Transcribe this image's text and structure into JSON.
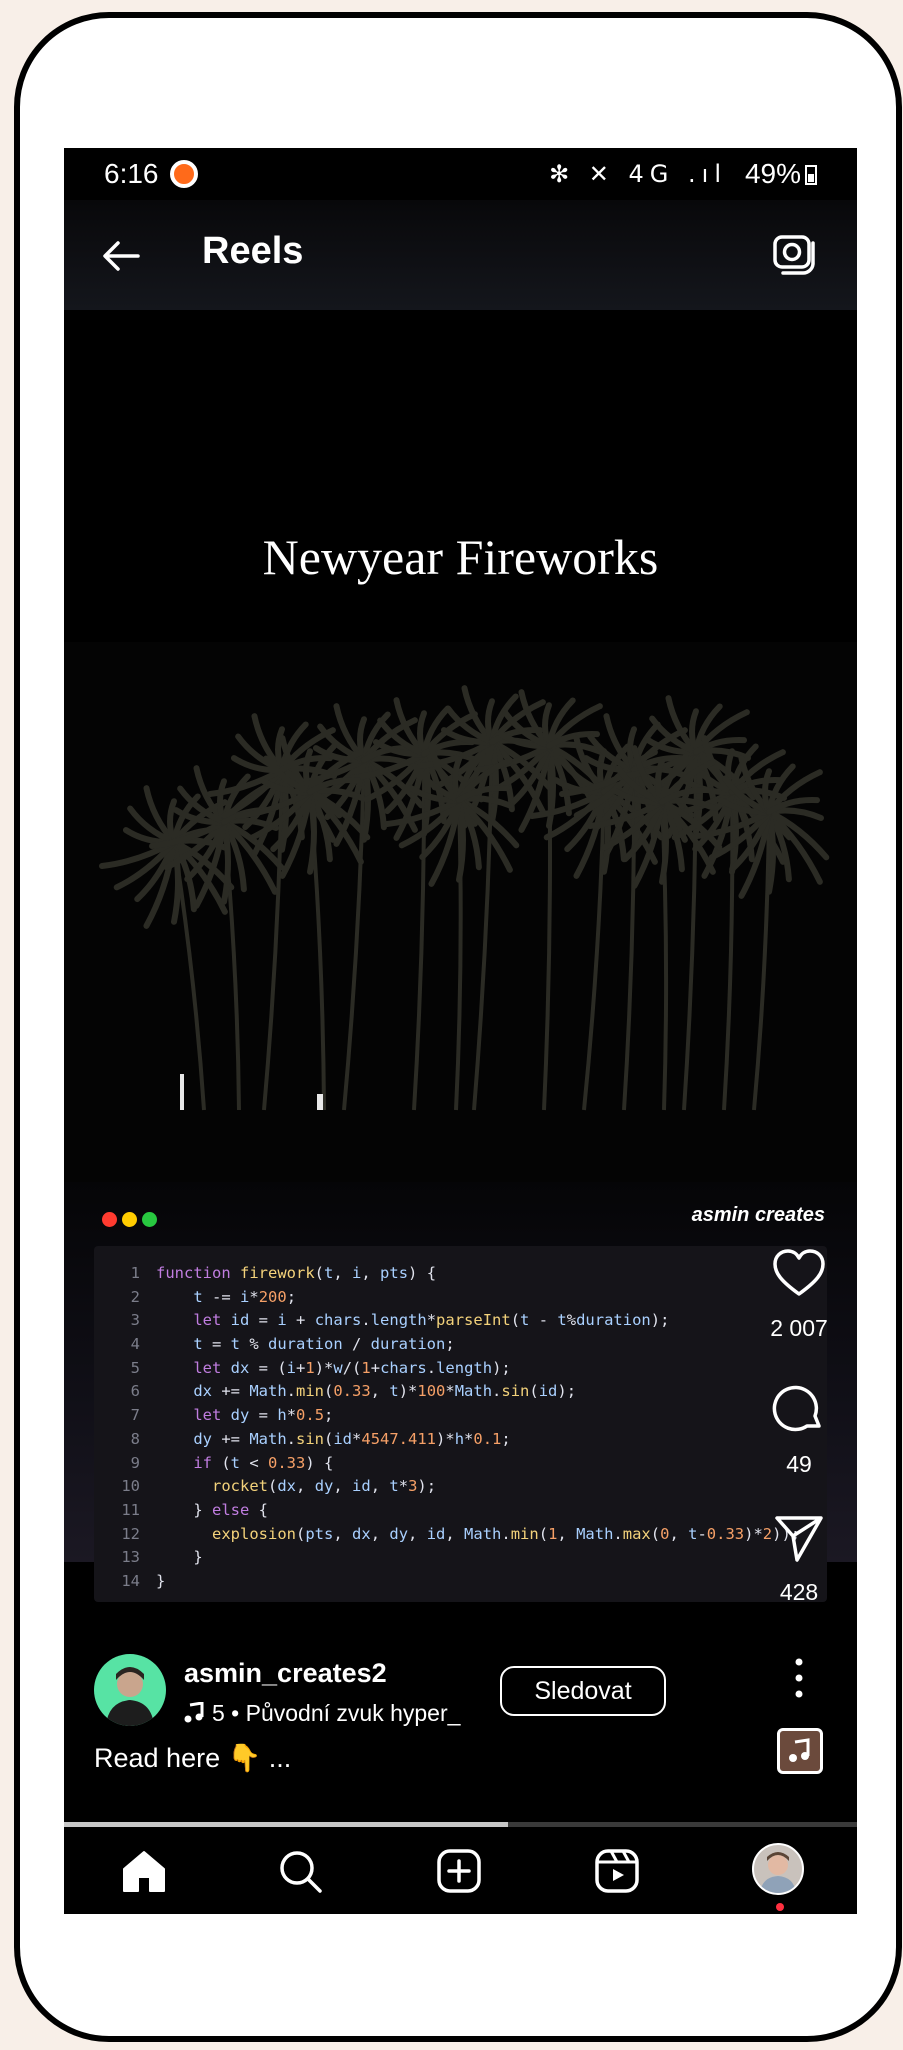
{
  "status_bar": {
    "time": "6:16",
    "icons": "✻ ✕ 4G .ıl",
    "battery": "49%"
  },
  "header": {
    "title": "Reels",
    "back_icon": "arrow-left-icon",
    "camera_icon": "camera-icon"
  },
  "video": {
    "title": "Newyear Fireworks",
    "brand": "asmin creates",
    "progress": 0.56,
    "code": [
      "function firework(t, i, pts) {",
      "    t -= i*200;",
      "    let id = i + chars.length*parseInt(t - t%duration);",
      "    t = t % duration / duration;",
      "    let dx = (i+1)*w/(1+chars.length);",
      "    dx += Math.min(0.33, t)*100*Math.sin(id);",
      "    let dy = h*0.5;",
      "    dy += Math.sin(id*4547.411)*h*0.1;",
      "    if (t < 0.33) {",
      "      rocket(dx, dy, id, t*3);",
      "    } else {",
      "      explosion(pts, dx, dy, id, Math.min(1, Math.max(0, t-0.33)*2));",
      "    }",
      "}"
    ]
  },
  "actions": {
    "likes": "2 007",
    "comments": "49",
    "shares": "428"
  },
  "author": {
    "username": "asmin_creates2",
    "audio": "5 • Původní zvuk   hyper_",
    "follow_label": "Sledovat",
    "caption": "Read here 👇 ..."
  },
  "colors": {
    "traffic_red": "#ff3b30",
    "traffic_yellow": "#ffcc00",
    "traffic_green": "#28c840",
    "notification": "#ff3040"
  },
  "nav": [
    "home-icon",
    "search-icon",
    "create-icon",
    "reels-icon",
    "profile-avatar"
  ]
}
